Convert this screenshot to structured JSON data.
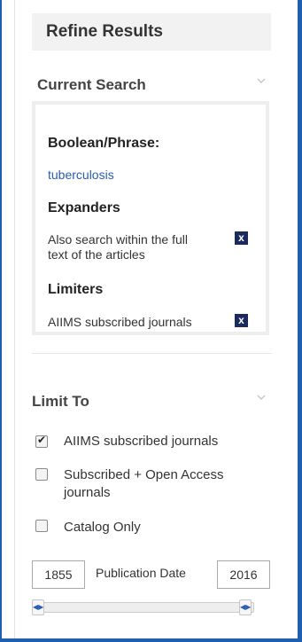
{
  "header": {
    "title": "Refine Results"
  },
  "current_search": {
    "title": "Current Search",
    "boolean_heading": "Boolean/Phrase:",
    "query": "tuberculosis",
    "expanders_heading": "Expanders",
    "expander_line1": "Also search within the full",
    "expander_line2": "text of the articles",
    "limiters_heading": "Limiters",
    "limiter_label": "AIIMS subscribed journals",
    "remove_label": "x"
  },
  "limit_to": {
    "title": "Limit To",
    "options": [
      {
        "label": "AIIMS subscribed journals",
        "checked": true
      },
      {
        "label_line1": "Subscribed + Open Access",
        "label_line2": "journals",
        "checked": false
      },
      {
        "label": "Catalog Only",
        "checked": false
      }
    ]
  },
  "pub_date": {
    "from": "1855",
    "label": "Publication Date",
    "to": "2016",
    "range_min": 1855,
    "range_max": 2016
  },
  "colors": {
    "frame": "#1f5fb0",
    "link": "#2a5db0",
    "remove_bg": "#1b2a5e"
  },
  "icons": {
    "collapse": "chevron-down-icon",
    "remove": "close-icon",
    "handle": "resize-horizontal-icon"
  }
}
